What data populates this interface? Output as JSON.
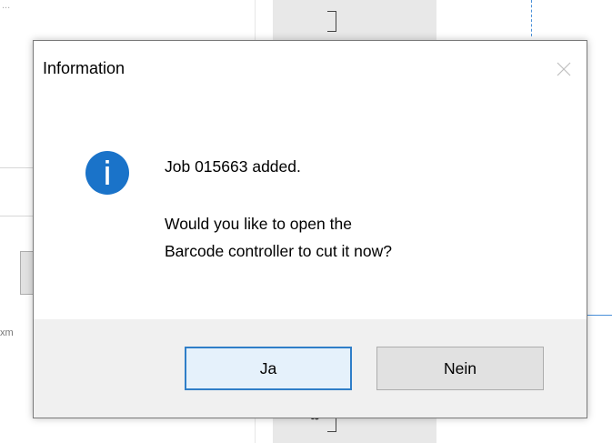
{
  "background": {
    "top_left_text": "...",
    "left_label": "xm",
    "bottom_ruler_label": "80"
  },
  "dialog": {
    "title": "Information",
    "icon": "info-icon",
    "icon_color": "#1a73c9",
    "message_line1": "Job 015663 added.",
    "message_line2": "Would you like to open the",
    "message_line3": "Barcode controller to cut it now?",
    "buttons": {
      "yes_label": "Ja",
      "no_label": "Nein"
    },
    "close_icon": "close-icon"
  },
  "colors": {
    "accent": "#2f7ec8",
    "footer_bg": "#f0f0f0",
    "button_bg": "#e1e1e1"
  }
}
